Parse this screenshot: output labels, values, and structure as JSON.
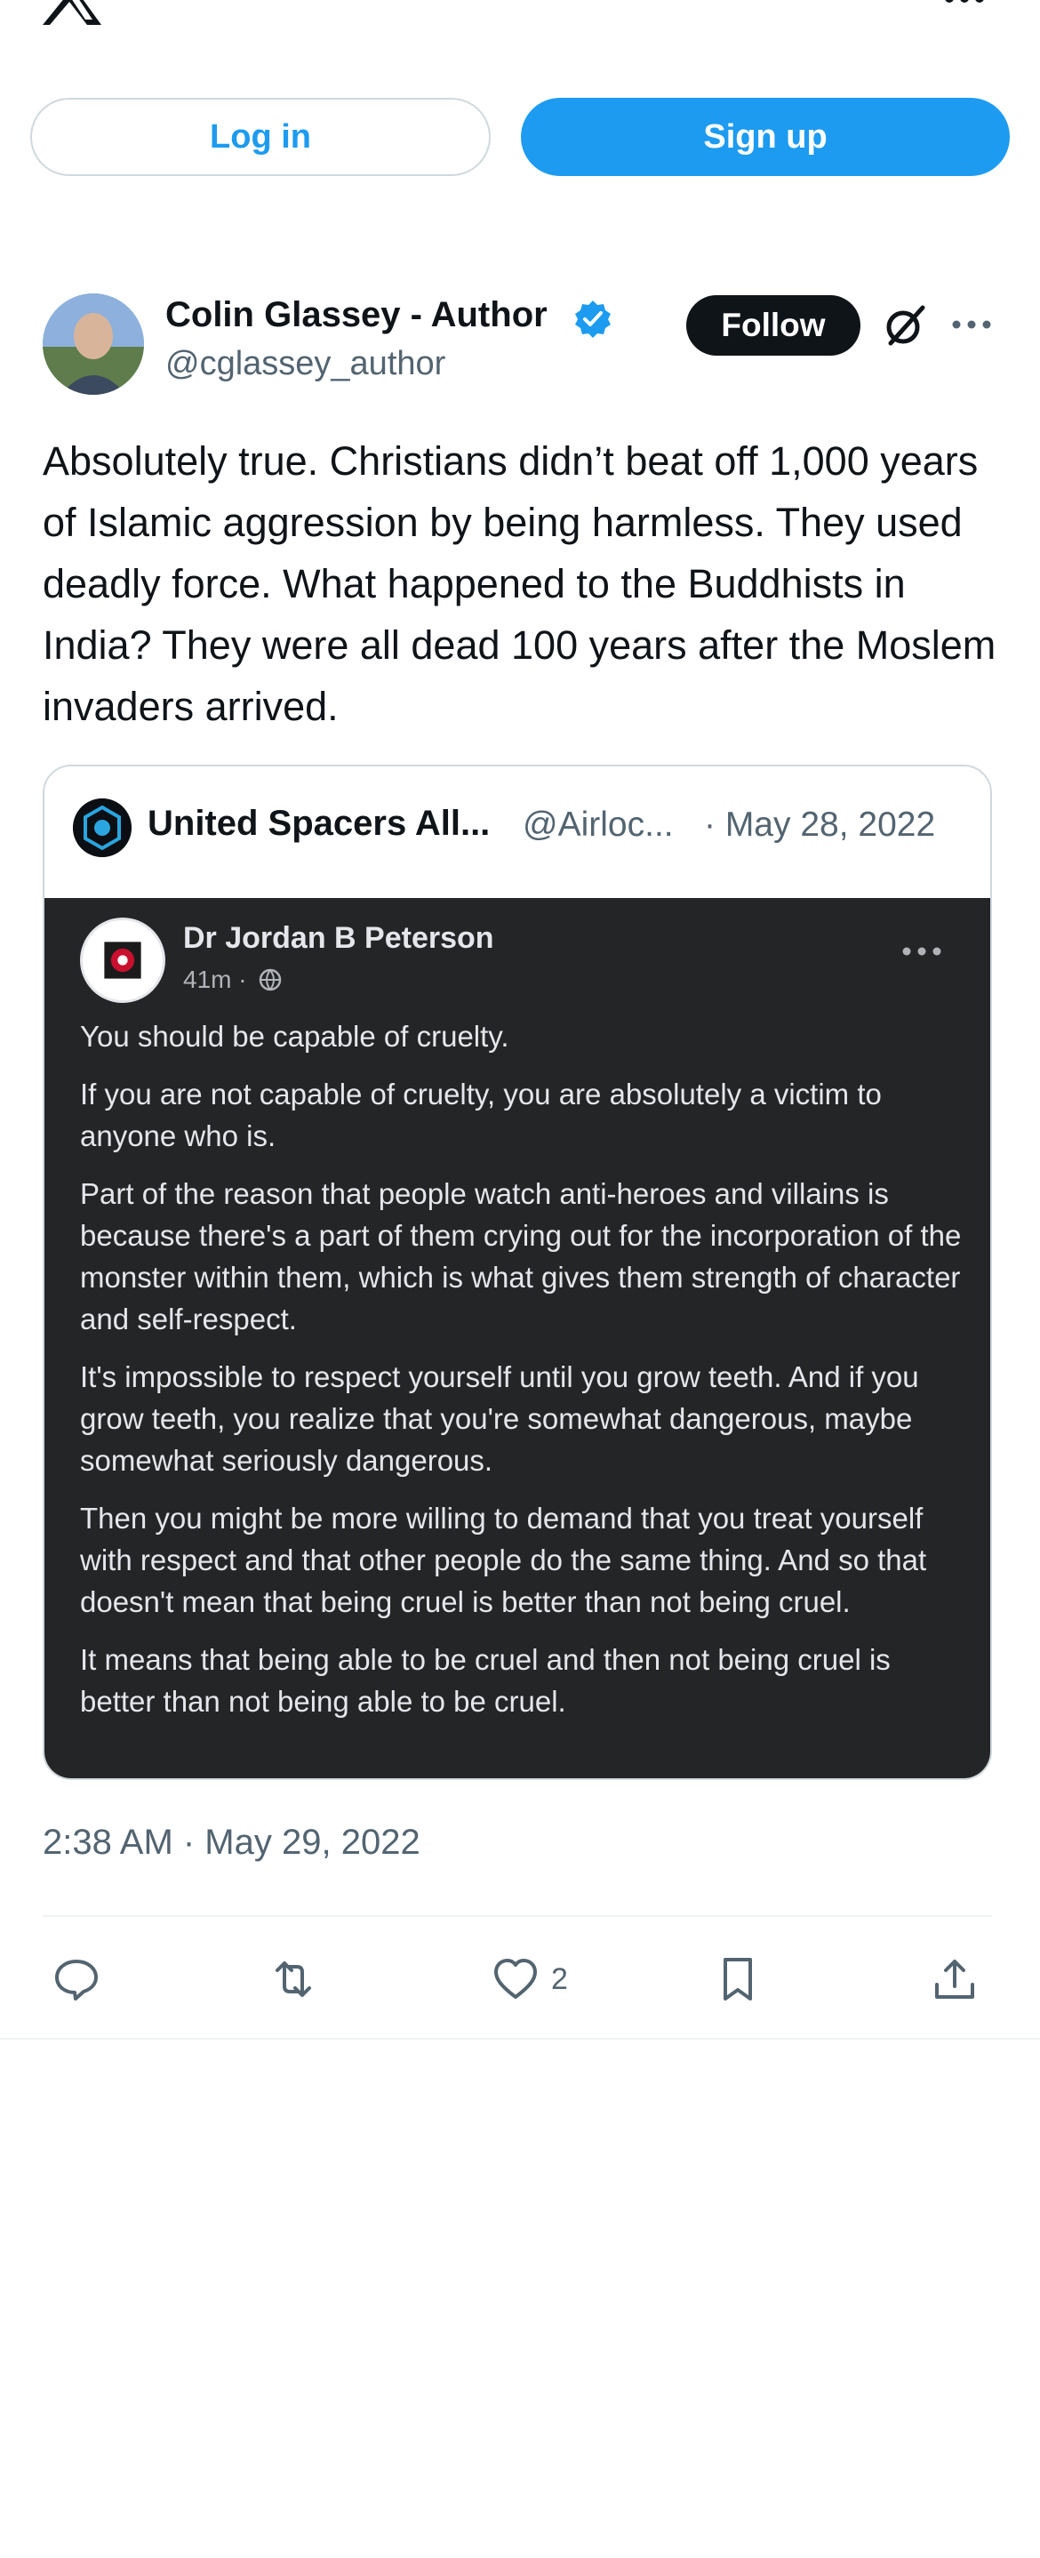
{
  "buttons": {
    "login": "Log in",
    "signup": "Sign up",
    "follow": "Follow"
  },
  "author": {
    "name": "Colin Glassey - Author",
    "handle": "@cglassey_author",
    "verified": true
  },
  "tweet": {
    "text": "Absolutely true. Christians didn’t beat off 1,000 years of Islamic aggression by being harmless. They used deadly force. What happened to the Buddhists in India? They were all dead 100 years after the Moslem invaders arrived.",
    "timestamp": "2:38 AM · May 29, 2022"
  },
  "quote": {
    "name": "United Spacers All...",
    "handle": "@Airloc...",
    "date": "· May 28, 2022",
    "post": {
      "author": "Dr Jordan B Peterson",
      "meta": "41m ·",
      "paragraphs": [
        "You should be capable of cruelty.",
        "If you are not capable of cruelty, you are absolutely a victim to anyone who is.",
        "Part of the reason that people watch anti-heroes and villains is because there's a part of them crying out for the incorporation of the monster within them, which is what gives them strength of character and self-respect.",
        "It's impossible to respect yourself until you grow teeth. And if you grow teeth, you realize that you're somewhat dangerous, maybe somewhat seriously dangerous.",
        "Then you might be more willing to demand that you treat yourself with respect and that other people do the same thing. And so that doesn't mean that being cruel is better than not being cruel.",
        "It means that being able to be cruel and then not being cruel is better than not being able to be cruel."
      ]
    }
  },
  "actions": {
    "like_count": "2"
  },
  "icons": [
    "x-logo-icon",
    "more-icon",
    "verified-badge-icon",
    "grok-icon",
    "globe-icon",
    "reply-icon",
    "retweet-icon",
    "like-icon",
    "bookmark-icon",
    "share-icon"
  ],
  "colors": {
    "accent": "#1d9bf0",
    "text": "#0f1419",
    "muted": "#536471",
    "border": "#cfd9de",
    "fb_bg": "#242526"
  }
}
